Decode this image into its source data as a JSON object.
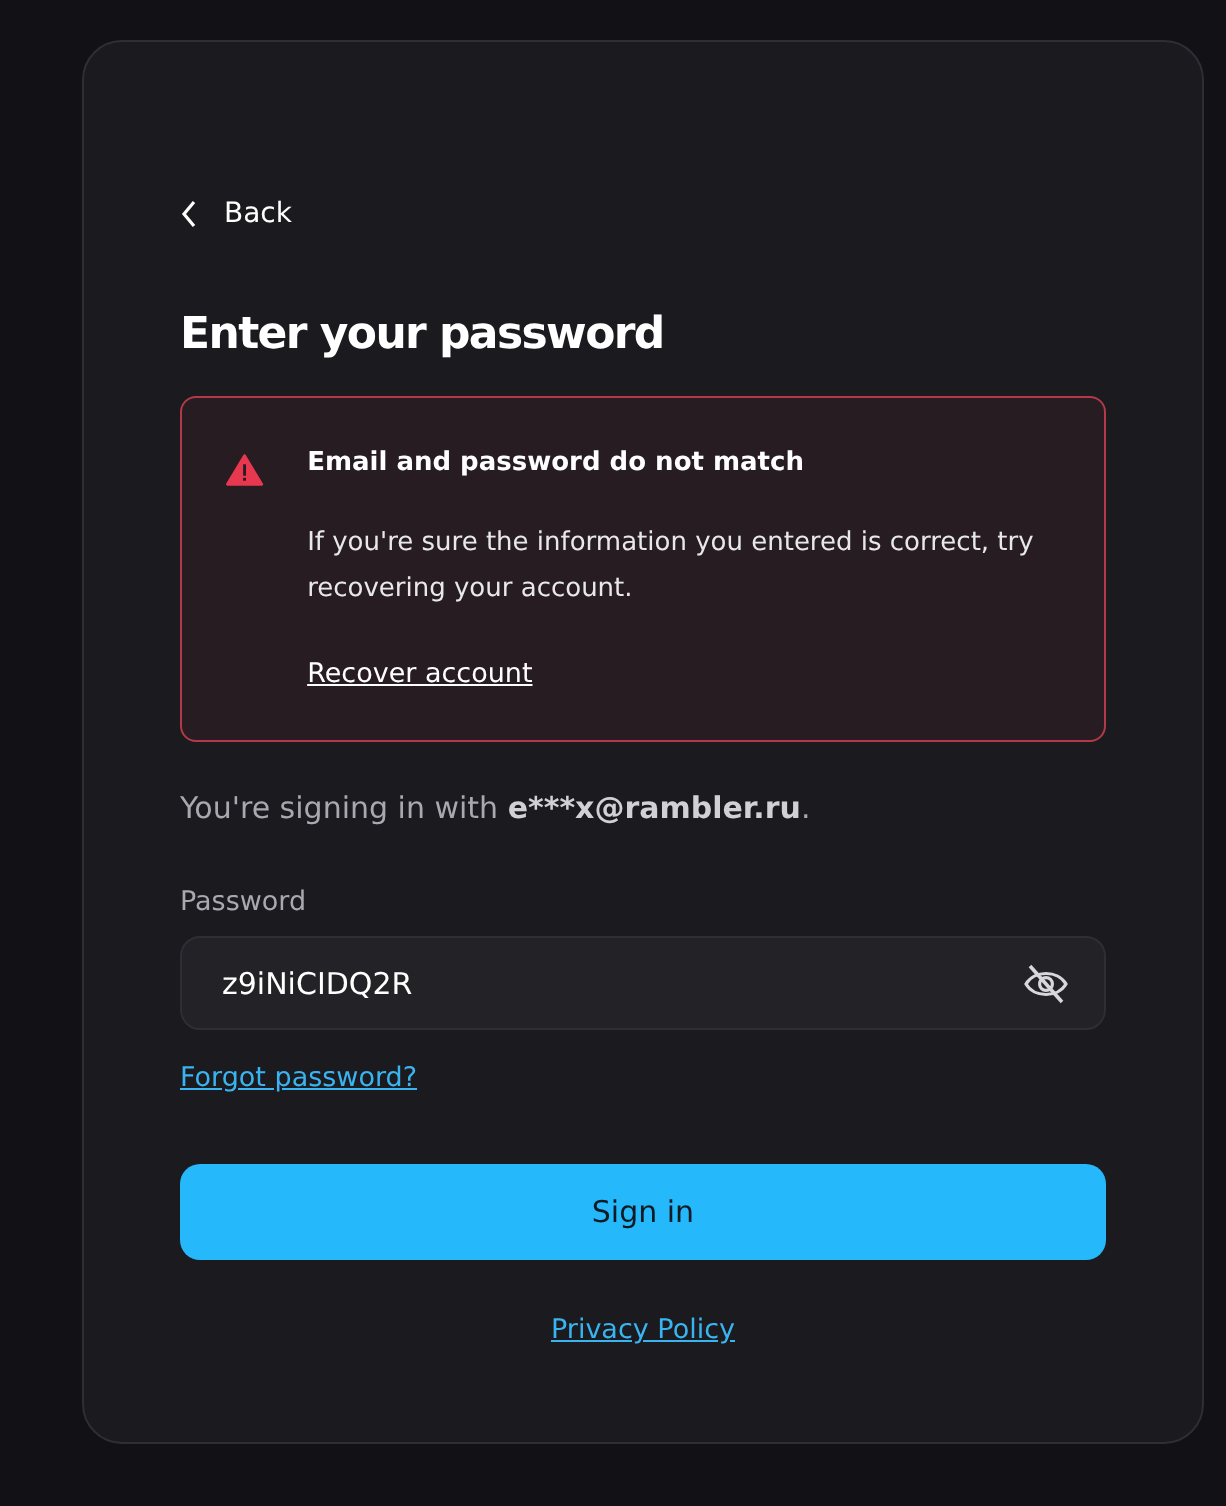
{
  "back": {
    "label": "Back"
  },
  "title": "Enter your password",
  "error": {
    "title": "Email and password do not match",
    "message": "If you're sure the information you entered is correct, try recovering your account.",
    "link": "Recover account"
  },
  "signing_in_with": {
    "prefix": "You're signing in with",
    "email": "e***x@rambler.ru",
    "suffix": "."
  },
  "password": {
    "label": "Password",
    "value": "z9iNiCIDQ2R"
  },
  "forgot_link": "Forgot password?",
  "submit": "Sign in",
  "privacy_link": "Privacy Policy"
}
